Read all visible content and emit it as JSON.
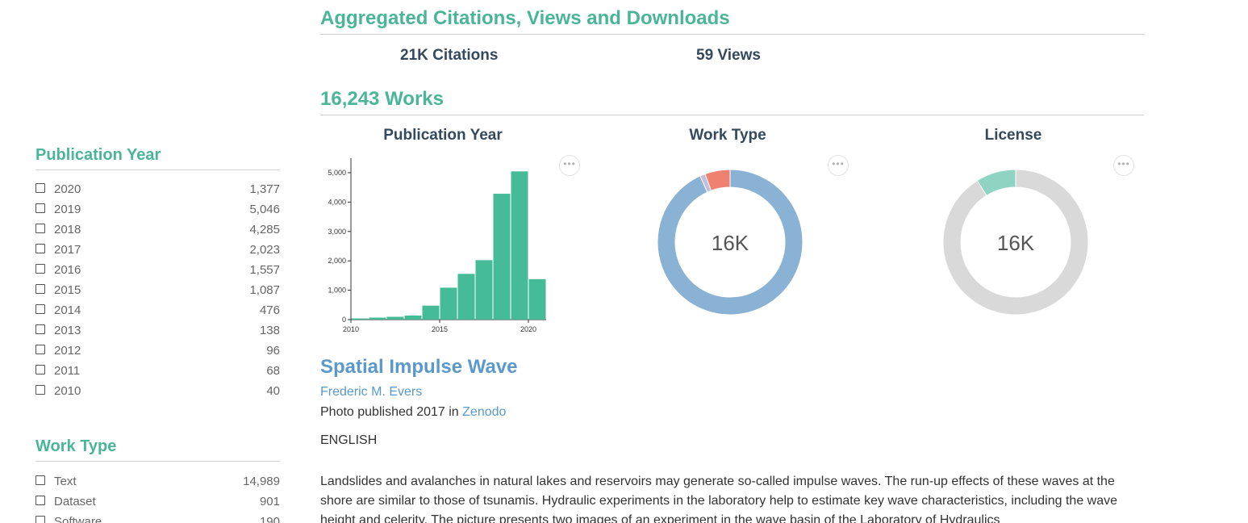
{
  "sidebar": {
    "publication_year": {
      "title": "Publication Year",
      "items": [
        {
          "label": "2020",
          "count": "1,377"
        },
        {
          "label": "2019",
          "count": "5,046"
        },
        {
          "label": "2018",
          "count": "4,285"
        },
        {
          "label": "2017",
          "count": "2,023"
        },
        {
          "label": "2016",
          "count": "1,557"
        },
        {
          "label": "2015",
          "count": "1,087"
        },
        {
          "label": "2014",
          "count": "476"
        },
        {
          "label": "2013",
          "count": "138"
        },
        {
          "label": "2012",
          "count": "96"
        },
        {
          "label": "2011",
          "count": "68"
        },
        {
          "label": "2010",
          "count": "40"
        }
      ]
    },
    "work_type": {
      "title": "Work Type",
      "items": [
        {
          "label": "Text",
          "count": "14,989"
        },
        {
          "label": "Dataset",
          "count": "901"
        },
        {
          "label": "Software",
          "count": "190"
        }
      ]
    }
  },
  "main": {
    "aggregated_title": "Aggregated Citations, Views and Downloads",
    "citations": "21K Citations",
    "views": "59 Views",
    "works_title": "16,243 Works",
    "charts": {
      "publication_year_title": "Publication Year",
      "work_type_title": "Work Type",
      "license_title": "License",
      "work_type_center": "16K",
      "license_center": "16K",
      "menu_glyph": "•••"
    },
    "work": {
      "title": "Spatial Impulse Wave",
      "author": "Frederic M. Evers",
      "published_prefix": "Photo published 2017 in ",
      "repository": "Zenodo",
      "language": "ENGLISH",
      "description": "Landslides and avalanches in natural lakes and reservoirs may generate so-called impulse waves. The run-up effects of these waves at the shore are similar to those of tsunamis. Hydraulic experiments in the laboratory help to estimate key wave characteristics, including the wave height and celerity. The picture presents two images of an experiment in the wave basin of the Laboratory of Hydraulics"
    }
  },
  "chart_data": [
    {
      "type": "bar",
      "title": "Publication Year",
      "x": [
        2010,
        2011,
        2012,
        2013,
        2014,
        2015,
        2016,
        2017,
        2018,
        2019,
        2020
      ],
      "values": [
        40,
        68,
        96,
        138,
        476,
        1087,
        1557,
        2023,
        4285,
        5046,
        1377
      ],
      "x_ticks": [
        "2010",
        "2015",
        "2020"
      ],
      "y_ticks": [
        "0",
        "1,000",
        "2,000",
        "3,000",
        "4,000",
        "5,000"
      ],
      "ylim": [
        0,
        5500
      ],
      "color": "#45bb98"
    },
    {
      "type": "pie",
      "title": "Work Type",
      "center_label": "16K",
      "slices": [
        {
          "value": 14989,
          "color": "#8ab2d5"
        },
        {
          "value": 190,
          "color": "#c4bddb"
        },
        {
          "value": 901,
          "color": "#ef8170"
        }
      ]
    },
    {
      "type": "pie",
      "title": "License",
      "center_label": "16K",
      "slices": [
        {
          "value": 14800,
          "color": "#d9d9d9"
        },
        {
          "value": 1443,
          "color": "#8fd3c3"
        }
      ]
    }
  ]
}
